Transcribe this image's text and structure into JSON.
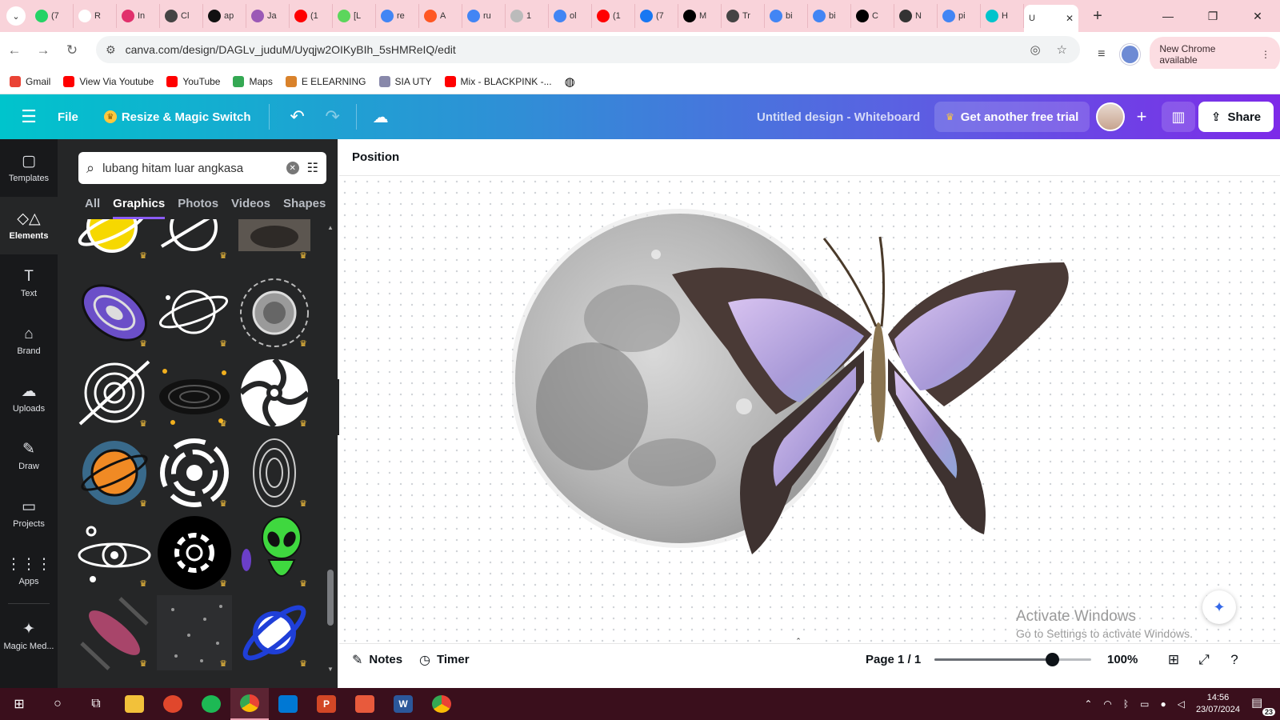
{
  "browser": {
    "tabs": [
      {
        "label": "(7",
        "icon": "whatsapp-icon",
        "color": "#25d366"
      },
      {
        "label": "R",
        "icon": "rapid-icon",
        "color": "#ffffff"
      },
      {
        "label": "In",
        "icon": "instagram-icon",
        "color": "#e1306c"
      },
      {
        "label": "Cl",
        "icon": "chatgpt-icon",
        "color": "#444444"
      },
      {
        "label": "ap",
        "icon": "app-icon",
        "color": "#111111"
      },
      {
        "label": "Ja",
        "icon": "jaipong-icon",
        "color": "#9b59b6"
      },
      {
        "label": "(1",
        "icon": "youtube-icon",
        "color": "#ff0000"
      },
      {
        "label": "[L",
        "icon": "kahoot-icon",
        "color": "#5cd65c"
      },
      {
        "label": "re",
        "icon": "google-icon",
        "color": "#4285f4"
      },
      {
        "label": "A",
        "icon": "six-icon",
        "color": "#ff5722"
      },
      {
        "label": "ru",
        "icon": "google-icon",
        "color": "#4285f4"
      },
      {
        "label": "1",
        "icon": "globe-icon",
        "color": "#bbbbbb"
      },
      {
        "label": "ol",
        "icon": "google-icon",
        "color": "#4285f4"
      },
      {
        "label": "(1",
        "icon": "youtube-icon",
        "color": "#ff0000"
      },
      {
        "label": "(7",
        "icon": "facebook-icon",
        "color": "#1877f2"
      },
      {
        "label": "M",
        "icon": "threads-icon",
        "color": "#000000"
      },
      {
        "label": "Tr",
        "icon": "chatgpt-icon",
        "color": "#444444"
      },
      {
        "label": "bi",
        "icon": "google-icon",
        "color": "#4285f4"
      },
      {
        "label": "bi",
        "icon": "google-icon",
        "color": "#4285f4"
      },
      {
        "label": "C",
        "icon": "tiktok-icon",
        "color": "#000000"
      },
      {
        "label": "N",
        "icon": "github-icon",
        "color": "#333333"
      },
      {
        "label": "pi",
        "icon": "google-icon",
        "color": "#4285f4"
      },
      {
        "label": "H",
        "icon": "canva-icon",
        "color": "#00c4cc"
      }
    ],
    "active_tab": {
      "label": "U",
      "close": "✕"
    },
    "new_tab": "+",
    "url": "canva.com/design/DAGLv_juduM/Uyqjw2OIKyBIh_5sHMReIQ/edit",
    "new_chrome": "New Chrome available",
    "bookmarks": [
      {
        "label": "Gmail",
        "color": "#ea4335"
      },
      {
        "label": "View Via Youtube",
        "color": "#ff0000"
      },
      {
        "label": "YouTube",
        "color": "#ff0000"
      },
      {
        "label": "Maps",
        "color": "#34a853"
      },
      {
        "label": "E ELEARNING",
        "color": "#d9822b"
      },
      {
        "label": "SIA UTY",
        "color": "#8888aa"
      },
      {
        "label": "Mix - BLACKPINK -...",
        "color": "#ff0000"
      }
    ]
  },
  "canva": {
    "file": "File",
    "resize": "Resize & Magic Switch",
    "title": "Untitled design - Whiteboard",
    "trial": "Get another free trial",
    "share": "Share",
    "rail": [
      {
        "label": "Templates",
        "icon": "▢"
      },
      {
        "label": "Elements",
        "icon": "◇△"
      },
      {
        "label": "Text",
        "icon": "T"
      },
      {
        "label": "Brand",
        "icon": "⌂"
      },
      {
        "label": "Uploads",
        "icon": "☁"
      },
      {
        "label": "Draw",
        "icon": "✎"
      },
      {
        "label": "Projects",
        "icon": "▭"
      },
      {
        "label": "Apps",
        "icon": "⋮⋮⋮"
      },
      {
        "label": "Magic Med...",
        "icon": "✦"
      }
    ],
    "search_value": "lubang hitam luar angkasa",
    "panel_tabs": [
      "All",
      "Graphics",
      "Photos",
      "Videos",
      "Shapes"
    ],
    "active_panel_tab": "Graphics",
    "toolbar_position": "Position",
    "watermark_line1": "Activate Windows",
    "watermark_line2": "Go to Settings to activate Windows.",
    "notes": "Notes",
    "timer": "Timer",
    "page": "Page 1 / 1",
    "zoom_fraction": 0.75,
    "zoom_label": "100%"
  },
  "taskbar": {
    "time": "14:56",
    "date": "23/07/2024",
    "notifications": "23"
  },
  "colors": {
    "canva_gradient_start": "#00c4cc",
    "canva_gradient_end": "#7d2ae8",
    "panel_bg": "#252627",
    "rail_bg": "#18191b",
    "tab_strip": "#f9d3da",
    "taskbar": "#3a0f1c"
  }
}
